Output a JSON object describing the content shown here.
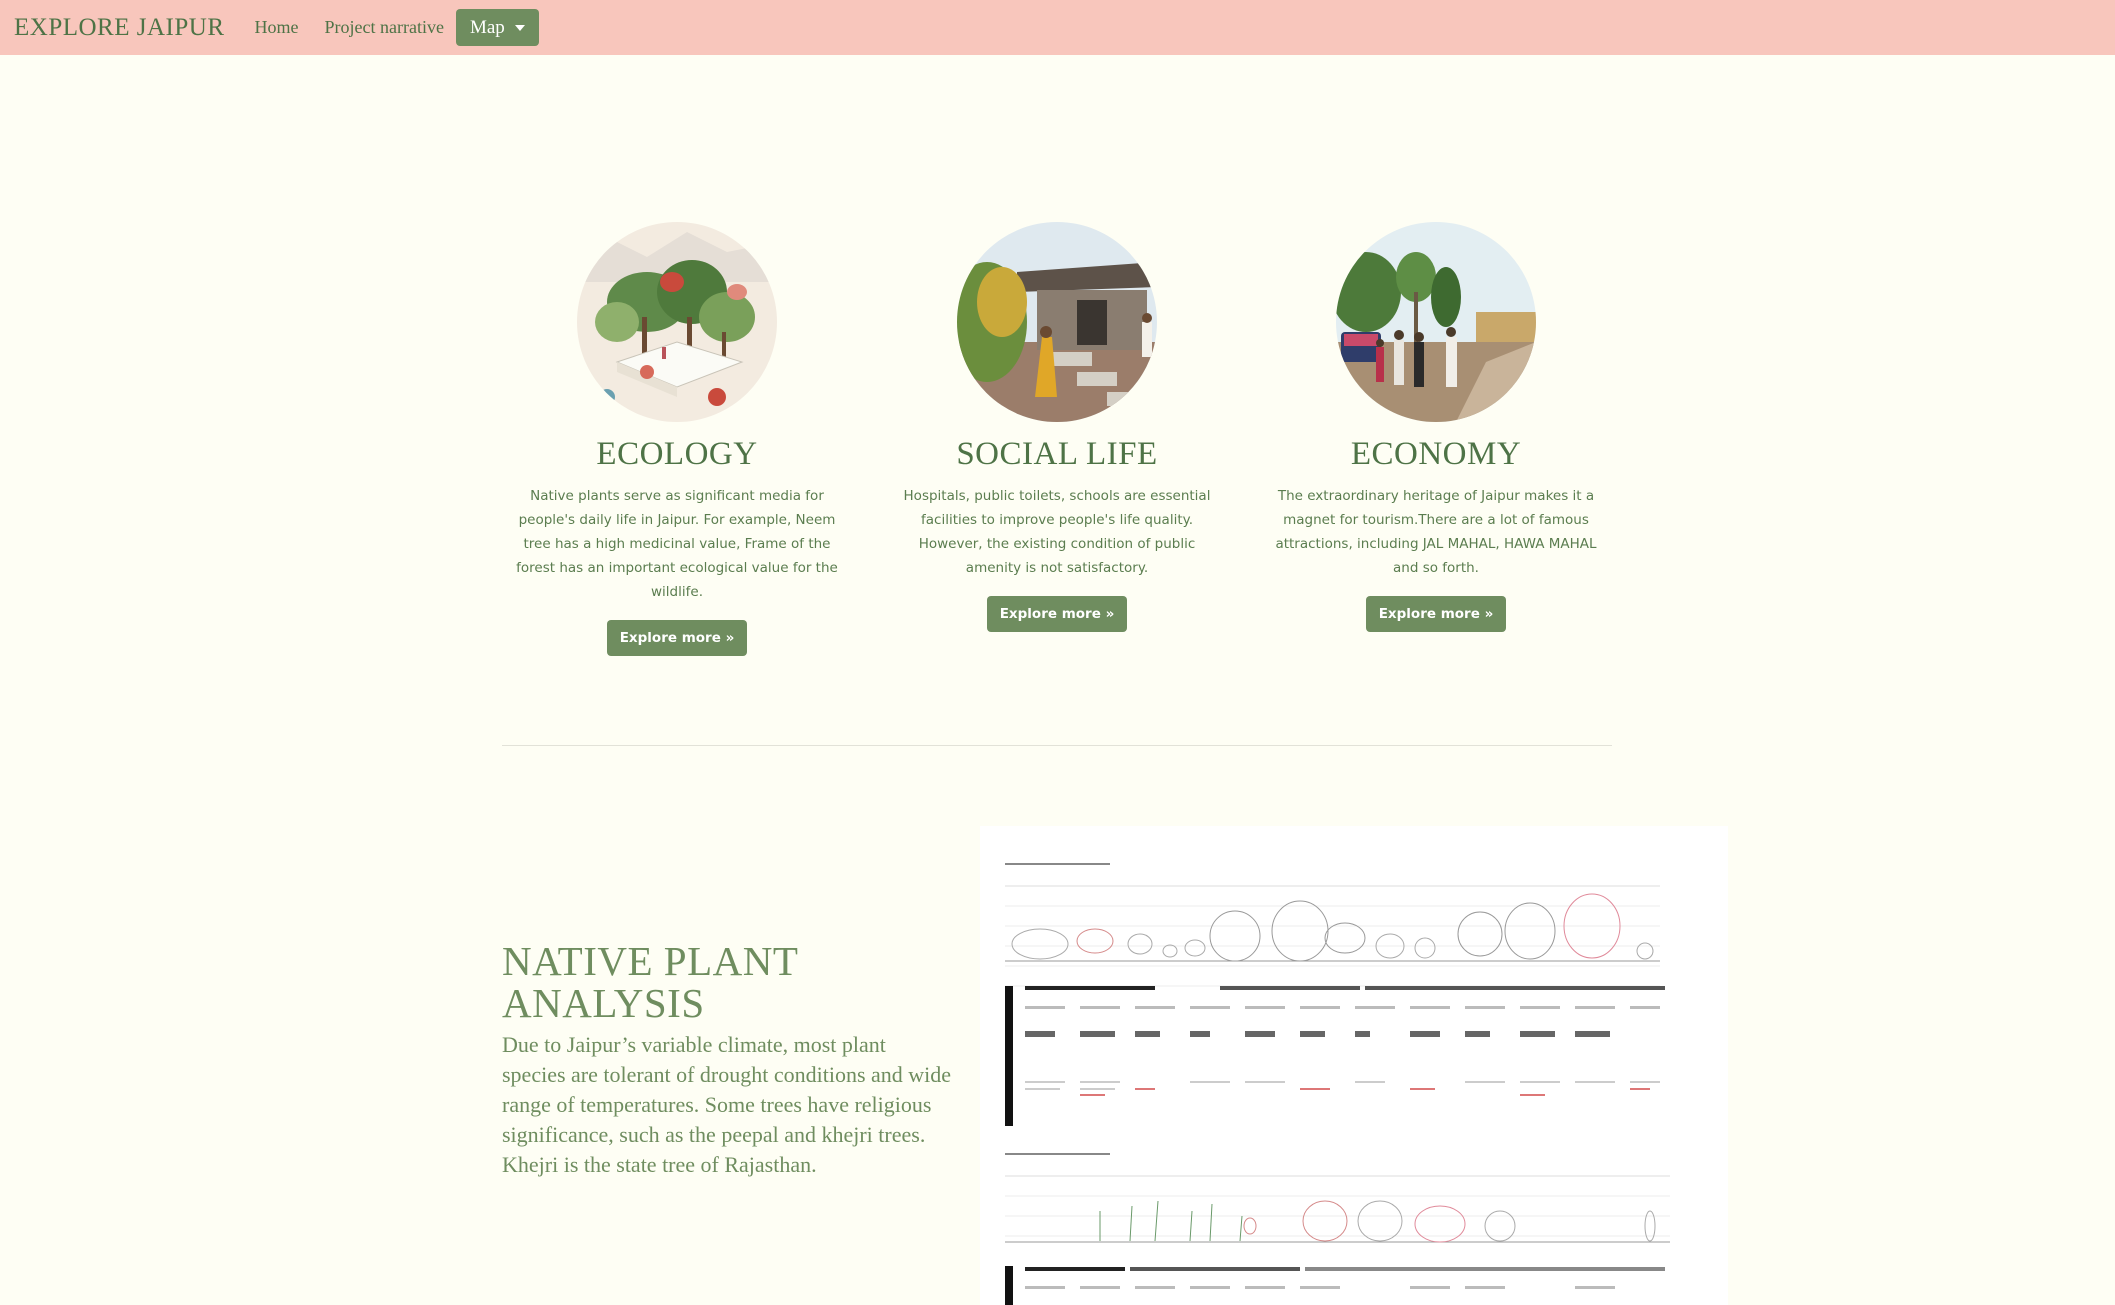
{
  "navbar": {
    "brand": "EXPLORE JAIPUR",
    "links": {
      "home": "Home",
      "narrative": "Project narrative",
      "map": "Map"
    },
    "background": "#f8c6bc",
    "accent": "#6f8d5f"
  },
  "cards": [
    {
      "title": "ECOLOGY",
      "text": "Native plants serve as significant media for people's daily life in Jaipur. For example, Neem tree has a high medicinal value, Frame of the forest has an important ecological value for the wildlife.",
      "button": "Explore more »"
    },
    {
      "title": "SOCIAL LIFE",
      "text": "Hospitals, public toilets, schools are essential facilities to improve people's life quality. However, the existing condition of public amenity is not satisfactory.",
      "button": "Explore more »"
    },
    {
      "title": "ECONOMY",
      "text": "The extraordinary heritage of Jaipur makes it a magnet for tourism.There are a lot of famous attractions, including JAL MAHAL, HAWA MAHAL and so forth.",
      "button": "Explore more »"
    }
  ],
  "analysis": {
    "title": "NATIVE PLANT ANALYSIS",
    "body": "Due to Jaipur’s variable climate, most plant species are tolerant of drought conditions and wide range of temperatures. Some trees have religious significance, such as the peepal and khejri trees. Khejri is the state tree of Rajasthan."
  },
  "colors": {
    "page_background": "#fefef4",
    "text_green": "#4e7346",
    "button_green": "#6f8d5f"
  }
}
